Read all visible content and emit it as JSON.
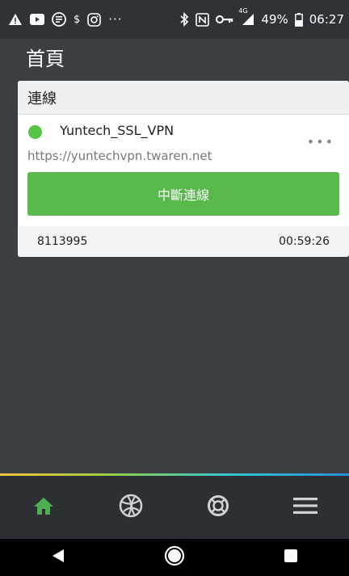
{
  "status_bar": {
    "battery": "49%",
    "time": "06:27",
    "network": "4G",
    "icons": [
      "warning-icon",
      "youtube-icon",
      "app-icon",
      "dollar-icon",
      "instagram-icon",
      "more-notifications-icon",
      "bluetooth-icon",
      "nfc-icon",
      "vpn-key-icon",
      "signal-icon",
      "battery-icon"
    ]
  },
  "header": {
    "title": "首頁"
  },
  "card": {
    "title": "連線",
    "vpn_name": "Yuntech_SSL_VPN",
    "vpn_url": "https://yuntechvpn.twaren.net",
    "more_label": "•••",
    "disconnect_label": "中斷連線",
    "session_id": "8113995",
    "elapsed": "00:59:26"
  },
  "bottom_nav": {
    "items": [
      "home-icon",
      "globe-icon",
      "help-lifebuoy-icon",
      "menu-icon"
    ],
    "active_color": "#4caf50"
  },
  "colors": {
    "connected": "#56c443",
    "button": "#56b949"
  },
  "system_nav": [
    "back-icon",
    "home-circle-icon",
    "recents-icon"
  ]
}
